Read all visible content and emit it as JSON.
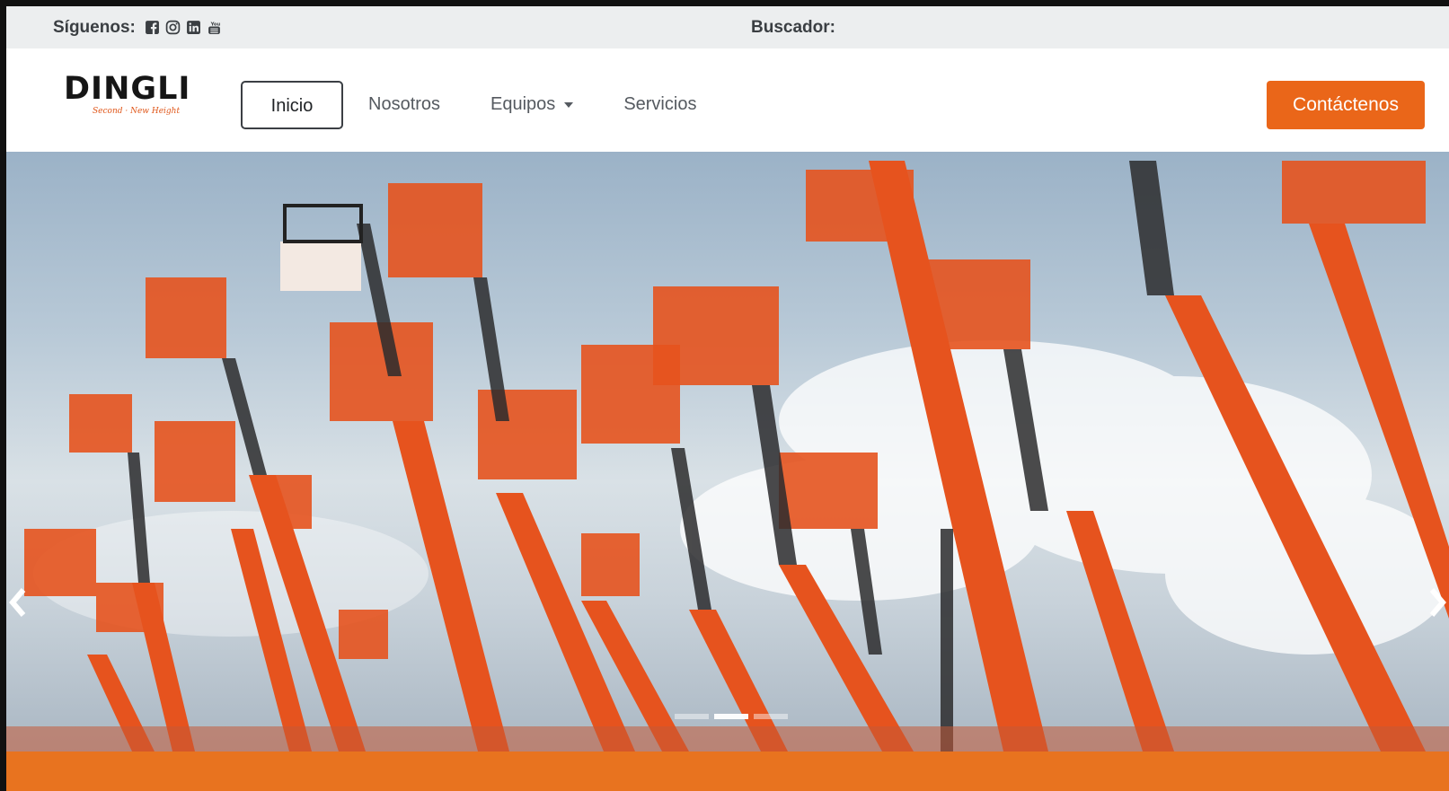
{
  "topbar": {
    "follow_label": "Síguenos:",
    "social_icons": [
      "facebook-icon",
      "instagram-icon",
      "linkedin-icon",
      "youtube-icon"
    ],
    "search_label": "Buscador:"
  },
  "logo": {
    "brand": "DINGLI",
    "tagline": "Second · New Height"
  },
  "nav": {
    "items": [
      {
        "label": "Inicio",
        "active": true
      },
      {
        "label": "Nosotros",
        "active": false
      },
      {
        "label": "Equipos",
        "active": false,
        "dropdown": true
      },
      {
        "label": "Servicios",
        "active": false
      }
    ],
    "cta_label": "Contáctenos"
  },
  "carousel": {
    "slides": 3,
    "active_slide": 2
  },
  "colors": {
    "accent": "#ea6619",
    "topbar_bg": "#eceeef",
    "boom_orange": "#e6531e"
  }
}
